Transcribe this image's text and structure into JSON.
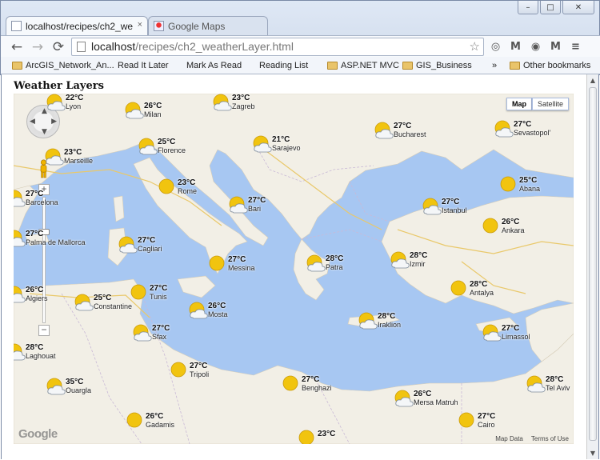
{
  "window": {
    "controls": [
      "–",
      "□",
      "✕"
    ]
  },
  "tabs": [
    {
      "title": "localhost/recipes/ch2_we",
      "close": "×"
    },
    {
      "title": "Google Maps",
      "close": ""
    }
  ],
  "toolbar": {
    "back": "←",
    "forward": "→",
    "reload": "⟳",
    "url_host": "localhost",
    "url_path": "/recipes/ch2_weatherLayer.html",
    "star": "☆",
    "extensions": [
      "◎",
      "M",
      "◉",
      "M",
      "≡"
    ]
  },
  "bookmarks": [
    {
      "label": "ArcGIS_Network_An...",
      "type": "folder"
    },
    {
      "label": "Read It Later",
      "type": "page"
    },
    {
      "label": "Mark As Read",
      "type": "page"
    },
    {
      "label": "Reading List",
      "type": "page"
    },
    {
      "label": "ASP.NET MVC",
      "type": "folder"
    },
    {
      "label": "GIS_Business",
      "type": "folder"
    },
    {
      "label": "»",
      "type": "chevron"
    },
    {
      "label": "Other bookmarks",
      "type": "folder"
    }
  ],
  "page": {
    "heading": "Weather Layers"
  },
  "map": {
    "type_buttons": [
      "Map",
      "Satellite"
    ],
    "logo": "Google",
    "attribution": [
      "Map Data",
      "Terms of Use"
    ],
    "zoom_in": "+",
    "zoom_out": "−",
    "colors": {
      "sea": "#a7c7f2",
      "land": "#f2efe6"
    },
    "weather": [
      {
        "temp": "22°C",
        "city": "Lyon",
        "icon": "sun-cloud-icon"
      },
      {
        "temp": "26°C",
        "city": "Milan",
        "icon": "sun-cloud-icon"
      },
      {
        "temp": "23°C",
        "city": "Zagreb",
        "icon": "sun-cloud-icon"
      },
      {
        "temp": "27°C",
        "city": "Bucharest",
        "icon": "sun-cloud-icon"
      },
      {
        "temp": "27°C",
        "city": "Sevastopol'",
        "icon": "sun-cloud-icon"
      },
      {
        "temp": "25°C",
        "city": "Florence",
        "icon": "sun-cloud-icon"
      },
      {
        "temp": "21°C",
        "city": "Sarajevo",
        "icon": "sun-cloud-icon"
      },
      {
        "temp": "23°C",
        "city": "Marseille",
        "icon": "sun-cloud-icon"
      },
      {
        "temp": "23°C",
        "city": "Rome",
        "icon": "sun-icon"
      },
      {
        "temp": "25°C",
        "city": "Abana",
        "icon": "sun-icon"
      },
      {
        "temp": "27°C",
        "city": "Barcelona",
        "icon": "sun-cloud-icon"
      },
      {
        "temp": "27°C",
        "city": "Bari",
        "icon": "sun-cloud-icon"
      },
      {
        "temp": "27°C",
        "city": "Istanbul",
        "icon": "sun-cloud-icon"
      },
      {
        "temp": "26°C",
        "city": "Ankara",
        "icon": "sun-icon"
      },
      {
        "temp": "27°C",
        "city": "Palma de Mallorca",
        "icon": "sun-cloud-icon"
      },
      {
        "temp": "27°C",
        "city": "Cagliari",
        "icon": "sun-cloud-icon"
      },
      {
        "temp": "27°C",
        "city": "Messina",
        "icon": "sun-icon"
      },
      {
        "temp": "28°C",
        "city": "Patra",
        "icon": "sun-cloud-icon"
      },
      {
        "temp": "28°C",
        "city": "Izmir",
        "icon": "sun-cloud-icon"
      },
      {
        "temp": "26°C",
        "city": "Algiers",
        "icon": "sun-cloud-icon"
      },
      {
        "temp": "25°C",
        "city": "Constantine",
        "icon": "sun-cloud-icon"
      },
      {
        "temp": "27°C",
        "city": "Tunis",
        "icon": "sun-icon"
      },
      {
        "temp": "28°C",
        "city": "Antalya",
        "icon": "sun-icon"
      },
      {
        "temp": "26°C",
        "city": "Mosta",
        "icon": "sun-cloud-icon"
      },
      {
        "temp": "28°C",
        "city": "Iraklion",
        "icon": "sun-cloud-icon"
      },
      {
        "temp": "27°C",
        "city": "Sfax",
        "icon": "sun-cloud-icon"
      },
      {
        "temp": "27°C",
        "city": "Limassol",
        "icon": "sun-cloud-icon"
      },
      {
        "temp": "28°C",
        "city": "Laghouat",
        "icon": "sun-cloud-icon"
      },
      {
        "temp": "27°C",
        "city": "Tripoli",
        "icon": "sun-icon"
      },
      {
        "temp": "27°C",
        "city": "Benghazi",
        "icon": "sun-icon"
      },
      {
        "temp": "35°C",
        "city": "Ouargla",
        "icon": "sun-cloud-icon"
      },
      {
        "temp": "26°C",
        "city": "Mersa Matruh",
        "icon": "sun-cloud-icon"
      },
      {
        "temp": "28°C",
        "city": "Tel Aviv",
        "icon": "sun-cloud-icon"
      },
      {
        "temp": "26°C",
        "city": "Gadamis",
        "icon": "sun-icon"
      },
      {
        "temp": "27°C",
        "city": "Cairo",
        "icon": "sun-icon"
      },
      {
        "temp": "23°C",
        "city": "",
        "icon": "sun-icon"
      }
    ]
  }
}
